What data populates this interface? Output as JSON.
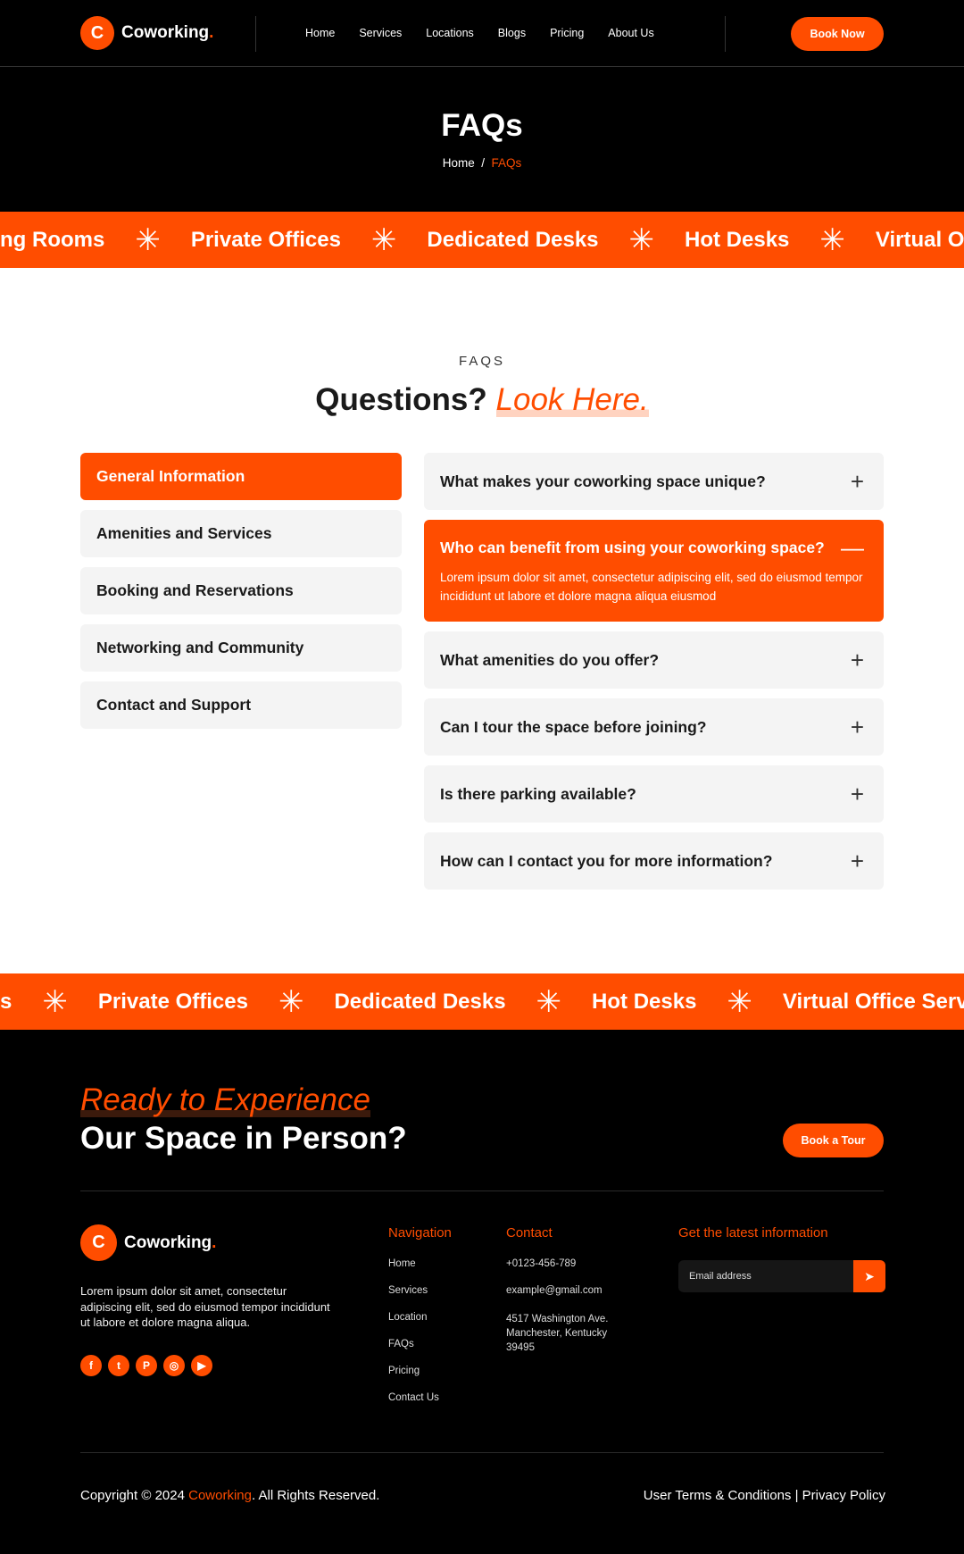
{
  "brand": {
    "name": "Coworking",
    "dot": ".",
    "accent": "#ff4d00",
    "logo_icon": "c-logo-icon"
  },
  "nav": {
    "items": [
      "Home",
      "Services",
      "Locations",
      "Blogs",
      "Pricing",
      "About Us"
    ],
    "cta": "Book Now"
  },
  "hero": {
    "title": "FAQs",
    "breadcrumb": {
      "home": "Home",
      "sep": "/",
      "current": "FAQs"
    }
  },
  "band_top": [
    "ng Rooms",
    "Private Offices",
    "Dedicated Desks",
    "Hot Desks",
    "Virtual O"
  ],
  "band_bottom": [
    "s",
    "Private Offices",
    "Dedicated Desks",
    "Hot Desks",
    "Virtual Office Servi"
  ],
  "band_icon": "asterisk-icon",
  "faq_section": {
    "label": "FAQS",
    "title": "Questions?",
    "title_accent": "Look Here.",
    "categories": [
      "General Information",
      "Amenities and Services",
      "Booking and Reservations",
      "Networking and Community",
      "Contact and Support"
    ],
    "active_category": 0,
    "questions": [
      {
        "q": "What makes your coworking space unique?",
        "open": false
      },
      {
        "q": "Who can benefit from using your coworking space?",
        "open": true,
        "a": "Lorem ipsum dolor sit amet, consectetur adipiscing elit, sed do eiusmod tempor incididunt ut labore et dolore magna aliqua eiusmod"
      },
      {
        "q": "What amenities do you offer?",
        "open": false
      },
      {
        "q": "Can I tour the space before joining?",
        "open": false
      },
      {
        "q": "Is there parking available?",
        "open": false
      },
      {
        "q": "How can I contact you for more information?",
        "open": false
      }
    ]
  },
  "cta": {
    "line1": "Ready to Experience",
    "line2": "Our Space in Person?",
    "button": "Book a Tour"
  },
  "footer": {
    "about": "Lorem ipsum dolor sit amet, consectetur adipiscing elit, sed do eiusmod tempor incididunt ut labore et dolore magna aliqua.",
    "social": [
      "facebook-icon",
      "twitter-icon",
      "pinterest-icon",
      "instagram-icon",
      "youtube-icon"
    ],
    "navigation": {
      "title": "Navigation",
      "links": [
        "Home",
        "Services",
        "Location",
        "FAQs",
        "Pricing",
        "Contact Us"
      ]
    },
    "contact": {
      "title": "Contact",
      "phone": "+0123-456-789",
      "email": "example@gmail.com",
      "address": [
        "4517 Washington Ave.",
        "Manchester, Kentucky",
        "39495"
      ]
    },
    "newsletter": {
      "title": "Get the latest information",
      "placeholder": "Email address"
    },
    "copyright": {
      "pre": "Copyright © 2024 ",
      "brand": "Coworking",
      "post": ". All Rights Reserved."
    },
    "legal": "User Terms & Conditions | Privacy Policy"
  }
}
